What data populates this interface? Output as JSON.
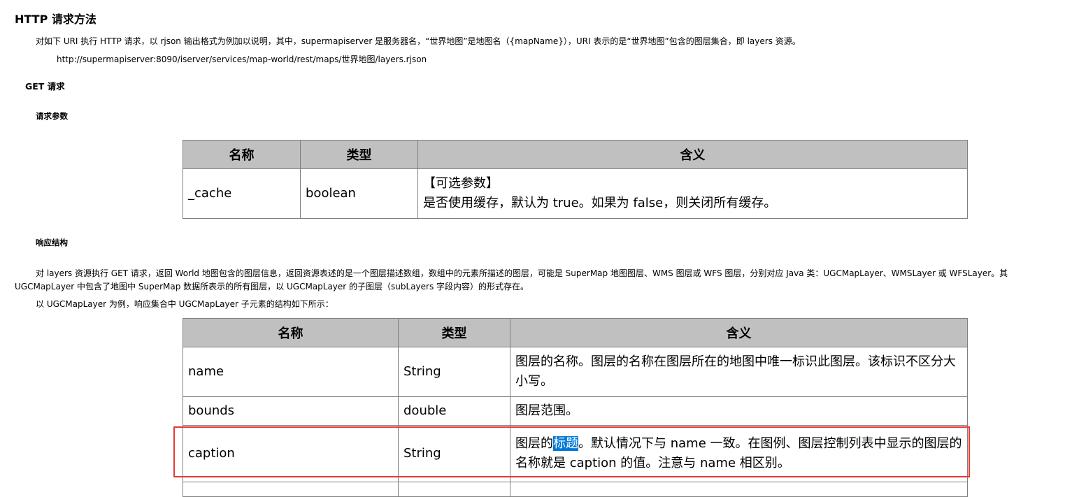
{
  "heading": "HTTP 请求方法",
  "intro": "对如下 URI 执行 HTTP 请求，以 rjson 输出格式为例加以说明，其中，supermapiserver 是服务器名，“世界地图”是地图名（{mapName}），URI 表示的是“世界地图”包含的图层集合，即 layers 资源。",
  "url": "http://supermapiserver:8090/iserver/services/map-world/rest/maps/世界地图/layers.rjson",
  "get_heading": "GET 请求",
  "params_heading": "请求参数",
  "params_table": {
    "headers": [
      "名称",
      "类型",
      "含义"
    ],
    "rows": [
      {
        "name": "_cache",
        "type": "boolean",
        "meaning_line1": "【可选参数】",
        "meaning_line2": "是否使用缓存，默认为 true。如果为 false，则关闭所有缓存。"
      }
    ]
  },
  "response_heading": "响应结构",
  "response_para_line1": "对 layers 资源执行 GET 请求，返回 World 地图包含的图层信息，返回资源表述的是一个图层描述数组，数组中的元素所描述的图层，可能是 SuperMap 地图图层、WMS 图层或 WFS 图层，分别对应 Java 类：UGCMapLayer、WMSLayer 或 WFSLayer。其",
  "response_para_line2": "UGCMapLayer 中包含了地图中 SuperMap 数据所表示的所有图层，以 UGCMapLayer 的子图层（subLayers 字段内容）的形式存在。",
  "example_line": "以 UGCMapLayer 为例，响应集合中 UGCMapLayer 子元素的结构如下所示：",
  "response_table": {
    "headers": [
      "名称",
      "类型",
      "含义"
    ],
    "rows": [
      {
        "name": "name",
        "type": "String",
        "meaning": "图层的名称。图层的名称在图层所在的地图中唯一标识此图层。该标识不区分大小写。"
      },
      {
        "name": "bounds",
        "type": "double",
        "meaning": "图层范围。"
      },
      {
        "name": "caption",
        "type": "String",
        "meaning_before": "图层的",
        "meaning_selected": "标题",
        "meaning_after": "。默认情况下与 name 一致。在图例、图层控制列表中显示的图层的名称就是 caption 的值。注意与 name 相区别。"
      }
    ]
  },
  "colors": {
    "header_bg": "#c0c0c0",
    "border": "#7f7f7f",
    "selection": "#0078d7",
    "highlight_box": "#e53935"
  }
}
